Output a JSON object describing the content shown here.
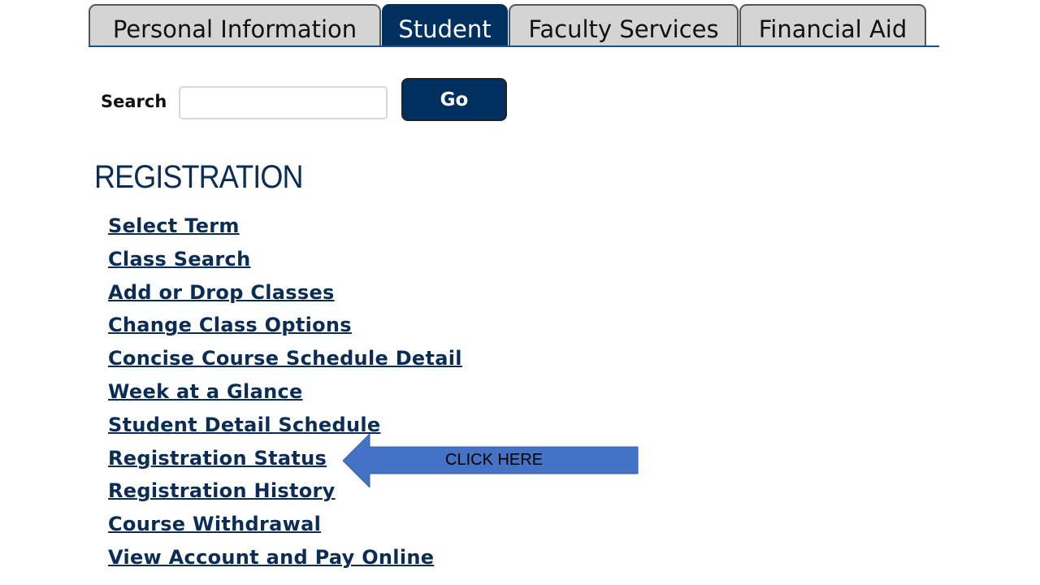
{
  "tabs": [
    {
      "label": "Personal Information",
      "active": false
    },
    {
      "label": "Student",
      "active": true
    },
    {
      "label": "Faculty Services",
      "active": false
    },
    {
      "label": "Financial Aid",
      "active": false
    }
  ],
  "search": {
    "label": "Search",
    "value": "",
    "placeholder": "",
    "button_label": "Go"
  },
  "section": {
    "heading": "REGISTRATION",
    "links": [
      "Select Term",
      "Class Search",
      "Add or Drop Classes",
      "Change Class Options",
      "Concise Course Schedule Detail",
      "Week at a Glance",
      "Student Detail Schedule",
      "Registration Status",
      "Registration History",
      "Course Withdrawal",
      "View Account and Pay Online"
    ]
  },
  "annotation": {
    "text": "CLICK HERE",
    "color": "#4472c4",
    "points_to": "Registration Status"
  }
}
